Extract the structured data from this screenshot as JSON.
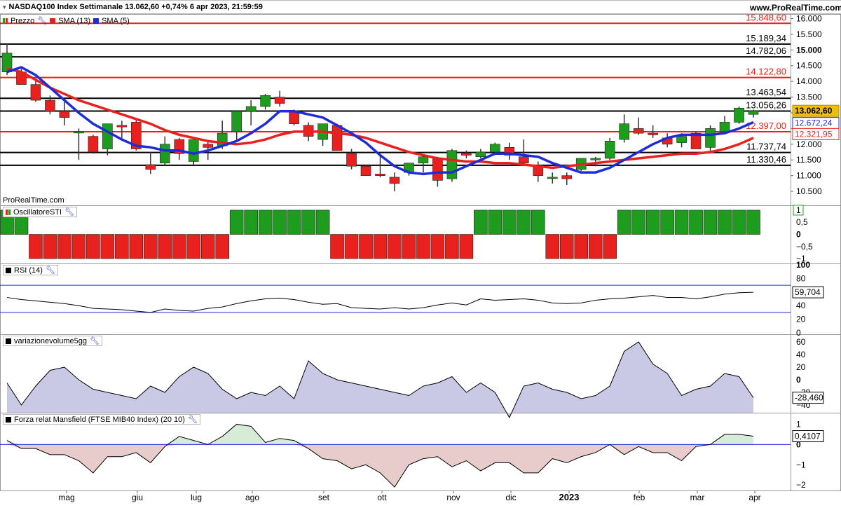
{
  "header": {
    "title": "NASDAQ100 Index Settimanale 13.062,60 +0,74% 6 apr 2023, 21:59:59",
    "site": "www.ProRealTime.com",
    "watermark": "ProRealTime.com"
  },
  "legend": {
    "prezzo": "Prezzo",
    "sma13": "SMA (13)",
    "sma5": "SMA (5)",
    "sti": "OscillatoreSTI",
    "rsi": "RSI (14)",
    "vol": "variazionevolume5gg",
    "mans": "Forza relat Mansfield (FTSE MIB40 Index) (20 10)"
  },
  "colors": {
    "up": "#1e9c1e",
    "down": "#e8201e",
    "sma13": "#e8201e",
    "sma5": "#1e2cd8",
    "level_red": "#e8201e",
    "level_black": "#000000",
    "price_badge": "#f0c000",
    "vol_fill": "#c9c9e6",
    "mans_pos": "#d6ecd6",
    "mans_neg": "#e8cccc"
  },
  "chart_data": [
    {
      "type": "candlestick",
      "title": "NASDAQ100 Index Settimanale",
      "ylim": [
        10100,
        16100
      ],
      "y_ticks": [
        "16.000",
        "15.500",
        "15.000",
        "14.500",
        "14.000",
        "13.500",
        "13.000",
        "12.500",
        "12.000",
        "11.500",
        "11.000",
        "10.500"
      ],
      "x_labels": [
        "mag",
        "giu",
        "lug",
        "ago",
        "set",
        "ott",
        "nov",
        "dic",
        "2023",
        "feb",
        "mar",
        "apr"
      ],
      "candles": [
        {
          "o": 14300,
          "h": 15200,
          "l": 14200,
          "c": 14900
        },
        {
          "o": 14300,
          "h": 14400,
          "l": 13900,
          "c": 13900
        },
        {
          "o": 13900,
          "h": 14050,
          "l": 13350,
          "c": 13400
        },
        {
          "o": 13400,
          "h": 13550,
          "l": 12950,
          "c": 13050
        },
        {
          "o": 13050,
          "h": 13350,
          "l": 12600,
          "c": 12850
        },
        {
          "o": 12400,
          "h": 12500,
          "l": 11500,
          "c": 12400
        },
        {
          "o": 12250,
          "h": 12300,
          "l": 11700,
          "c": 11750
        },
        {
          "o": 11850,
          "h": 12650,
          "l": 11650,
          "c": 12650
        },
        {
          "o": 12600,
          "h": 12750,
          "l": 12150,
          "c": 12550
        },
        {
          "o": 12700,
          "h": 12800,
          "l": 11800,
          "c": 11850
        },
        {
          "o": 11350,
          "h": 11750,
          "l": 11050,
          "c": 11200
        },
        {
          "o": 11400,
          "h": 12250,
          "l": 11350,
          "c": 12000
        },
        {
          "o": 12150,
          "h": 12200,
          "l": 11500,
          "c": 11700
        },
        {
          "o": 11450,
          "h": 12150,
          "l": 11350,
          "c": 12150
        },
        {
          "o": 12000,
          "h": 12100,
          "l": 11500,
          "c": 11900
        },
        {
          "o": 11950,
          "h": 12750,
          "l": 11850,
          "c": 12350
        },
        {
          "o": 12400,
          "h": 13050,
          "l": 12100,
          "c": 13050
        },
        {
          "o": 13050,
          "h": 13400,
          "l": 12600,
          "c": 13200
        },
        {
          "o": 13200,
          "h": 13600,
          "l": 13100,
          "c": 13550
        },
        {
          "o": 13500,
          "h": 13700,
          "l": 13200,
          "c": 13300
        },
        {
          "o": 13050,
          "h": 13100,
          "l": 12600,
          "c": 12650
        },
        {
          "o": 12600,
          "h": 12700,
          "l": 12100,
          "c": 12250
        },
        {
          "o": 12150,
          "h": 12650,
          "l": 11950,
          "c": 12650
        },
        {
          "o": 12600,
          "h": 12650,
          "l": 11800,
          "c": 11800
        },
        {
          "o": 11700,
          "h": 11850,
          "l": 11200,
          "c": 11300
        },
        {
          "o": 11300,
          "h": 11350,
          "l": 11000,
          "c": 11000
        },
        {
          "o": 11050,
          "h": 11650,
          "l": 10950,
          "c": 11000
        },
        {
          "o": 10950,
          "h": 11100,
          "l": 10500,
          "c": 10750
        },
        {
          "o": 11100,
          "h": 11400,
          "l": 11000,
          "c": 11400
        },
        {
          "o": 11400,
          "h": 11650,
          "l": 11100,
          "c": 11600
        },
        {
          "o": 11550,
          "h": 11600,
          "l": 10650,
          "c": 10850
        },
        {
          "o": 10900,
          "h": 11850,
          "l": 10800,
          "c": 11800
        },
        {
          "o": 11700,
          "h": 11800,
          "l": 11550,
          "c": 11650
        },
        {
          "o": 11600,
          "h": 11850,
          "l": 11550,
          "c": 11750
        },
        {
          "o": 11750,
          "h": 12050,
          "l": 11650,
          "c": 12000
        },
        {
          "o": 11900,
          "h": 12050,
          "l": 11500,
          "c": 11650
        },
        {
          "o": 11600,
          "h": 12150,
          "l": 11350,
          "c": 11400
        },
        {
          "o": 11300,
          "h": 11450,
          "l": 10800,
          "c": 11000
        },
        {
          "o": 10950,
          "h": 11100,
          "l": 10750,
          "c": 10950
        },
        {
          "o": 11000,
          "h": 11100,
          "l": 10700,
          "c": 10900
        },
        {
          "o": 11200,
          "h": 11550,
          "l": 11150,
          "c": 11550
        },
        {
          "o": 11500,
          "h": 11600,
          "l": 11300,
          "c": 11550
        },
        {
          "o": 11550,
          "h": 12200,
          "l": 11500,
          "c": 12100
        },
        {
          "o": 12150,
          "h": 12950,
          "l": 12050,
          "c": 12650
        },
        {
          "o": 12500,
          "h": 12850,
          "l": 12300,
          "c": 12350
        },
        {
          "o": 12350,
          "h": 12600,
          "l": 12200,
          "c": 12300
        },
        {
          "o": 12200,
          "h": 12350,
          "l": 11900,
          "c": 12000
        },
        {
          "o": 12050,
          "h": 12350,
          "l": 11900,
          "c": 12250
        },
        {
          "o": 12350,
          "h": 12400,
          "l": 11850,
          "c": 11850
        },
        {
          "o": 11900,
          "h": 12600,
          "l": 11700,
          "c": 12500
        },
        {
          "o": 12400,
          "h": 12900,
          "l": 12350,
          "c": 12700
        },
        {
          "o": 12700,
          "h": 13200,
          "l": 12650,
          "c": 13150
        },
        {
          "o": 12950,
          "h": 13100,
          "l": 12850,
          "c": 13060
        }
      ],
      "series": [
        {
          "name": "SMA (13)",
          "values": [
            14400,
            14300,
            14050,
            13800,
            13600,
            13400,
            13250,
            13100,
            12950,
            12800,
            12650,
            12450,
            12300,
            12200,
            12100,
            12050,
            12000,
            12050,
            12150,
            12300,
            12400,
            12400,
            12400,
            12350,
            12300,
            12200,
            12050,
            11900,
            11750,
            11650,
            11550,
            11500,
            11450,
            11450,
            11400,
            11400,
            11350,
            11300,
            11250,
            11300,
            11350,
            11400,
            11450,
            11500,
            11550,
            11600,
            11650,
            11700,
            11700,
            11750,
            11850,
            12000,
            12200
          ]
        },
        {
          "name": "SMA (5)",
          "values": [
            14300,
            14450,
            14200,
            13800,
            13400,
            13000,
            12650,
            12400,
            12150,
            11950,
            11900,
            11800,
            11800,
            11700,
            11800,
            11950,
            12100,
            12350,
            12650,
            13050,
            13050,
            12950,
            12850,
            12600,
            12350,
            12050,
            11650,
            11300,
            11100,
            11050,
            11100,
            11100,
            11300,
            11500,
            11700,
            11700,
            11650,
            11600,
            11400,
            11250,
            11100,
            11100,
            11250,
            11500,
            11750,
            12000,
            12200,
            12300,
            12300,
            12300,
            12350,
            12500,
            12700
          ]
        }
      ],
      "levels": [
        {
          "value": 15848.6,
          "label": "15.848,60",
          "color": "red"
        },
        {
          "value": 15189.34,
          "label": "15.189,34",
          "color": "black"
        },
        {
          "value": 14782.06,
          "label": "14.782,06",
          "color": "black"
        },
        {
          "value": 14122.8,
          "label": "14.122,80",
          "color": "red"
        },
        {
          "value": 13463.54,
          "label": "13.463,54",
          "color": "black"
        },
        {
          "value": 13056.26,
          "label": "13.056,26",
          "color": "black"
        },
        {
          "value": 12397.0,
          "label": "12.397,00",
          "color": "red"
        },
        {
          "value": 11737.74,
          "label": "11.737,74",
          "color": "black"
        },
        {
          "value": 11330.46,
          "label": "11.330,46",
          "color": "black"
        }
      ],
      "badges": [
        {
          "value": 13062.6,
          "label": "13.062,60"
        },
        {
          "value": 12672.24,
          "label": "12.672,24"
        },
        {
          "value": 12321.95,
          "label": "12.321,95"
        }
      ]
    },
    {
      "type": "bar",
      "title": "OscillatoreSTI",
      "ylim": [
        -1.2,
        1.2
      ],
      "y_ticks": [
        "1",
        "0,5",
        "0",
        "−0,5",
        "−1"
      ],
      "values": [
        1,
        1,
        -1,
        -1,
        -1,
        -1,
        -1,
        -1,
        -1,
        -1,
        -1,
        -1,
        -1,
        -1,
        -1,
        -1,
        1,
        1,
        1,
        1,
        1,
        1,
        1,
        -1,
        -1,
        -1,
        -1,
        -1,
        -1,
        -1,
        -1,
        -1,
        -1,
        1,
        1,
        1,
        1,
        1,
        -1,
        -1,
        -1,
        -1,
        -1,
        1,
        1,
        1,
        1,
        1,
        1,
        1,
        1,
        1,
        1
      ]
    },
    {
      "type": "line",
      "title": "RSI (14)",
      "ylim": [
        0,
        100
      ],
      "y_ticks": [
        "100",
        "80",
        "60",
        "40",
        "20",
        "0"
      ],
      "bands": [
        30,
        70
      ],
      "values": [
        52,
        49,
        47,
        45,
        43,
        40,
        36,
        35,
        34,
        32,
        30,
        35,
        33,
        32,
        36,
        38,
        43,
        47,
        50,
        51,
        49,
        45,
        42,
        43,
        37,
        36,
        35,
        37,
        35,
        37,
        41,
        44,
        41,
        50,
        48,
        49,
        50,
        48,
        44,
        43,
        44,
        48,
        50,
        51,
        53,
        55,
        52,
        52,
        50,
        53,
        57,
        59,
        59.7
      ],
      "value_label": "59,704"
    },
    {
      "type": "area",
      "title": "variazionevolume5gg",
      "ylim": [
        -50,
        70
      ],
      "y_ticks": [
        "60",
        "40",
        "20",
        "0",
        "−20",
        "−40"
      ],
      "values": [
        -5,
        -40,
        -10,
        15,
        20,
        0,
        -15,
        -20,
        -25,
        -30,
        -10,
        -20,
        5,
        20,
        10,
        -15,
        -30,
        -20,
        -25,
        -10,
        -30,
        30,
        10,
        0,
        -5,
        -10,
        -15,
        -20,
        -25,
        -10,
        -5,
        5,
        -20,
        -5,
        -20,
        -60,
        -10,
        -5,
        -15,
        -20,
        -30,
        -25,
        -10,
        45,
        60,
        25,
        10,
        -25,
        -15,
        -10,
        10,
        5,
        -28.46
      ],
      "value_label": "-28,460"
    },
    {
      "type": "area",
      "title": "Forza relat Mansfield (FTSE MIB40 Index) (20 10)",
      "ylim": [
        -2.2,
        1.5
      ],
      "y_ticks": [
        "1",
        "0",
        "−1",
        "−2"
      ],
      "values": [
        0.2,
        -0.2,
        -0.2,
        -0.5,
        -0.5,
        -0.8,
        -1.4,
        -0.6,
        -0.6,
        -0.4,
        -0.9,
        -0.1,
        0.4,
        0.2,
        0,
        0.4,
        1.0,
        0.9,
        0.1,
        0.3,
        0.2,
        -0.2,
        -0.7,
        -0.8,
        -1.2,
        -1.0,
        -1.4,
        -2.1,
        -1.0,
        -0.7,
        -0.6,
        -1.1,
        -0.8,
        -1.3,
        -0.9,
        -0.9,
        -1.4,
        -1.4,
        -0.7,
        -0.9,
        -0.6,
        -0.4,
        0,
        -0.5,
        -0.1,
        -0.4,
        -0.4,
        -0.8,
        -0.1,
        0,
        0.5,
        0.5,
        0.41
      ],
      "value_label": "0,4107"
    }
  ]
}
